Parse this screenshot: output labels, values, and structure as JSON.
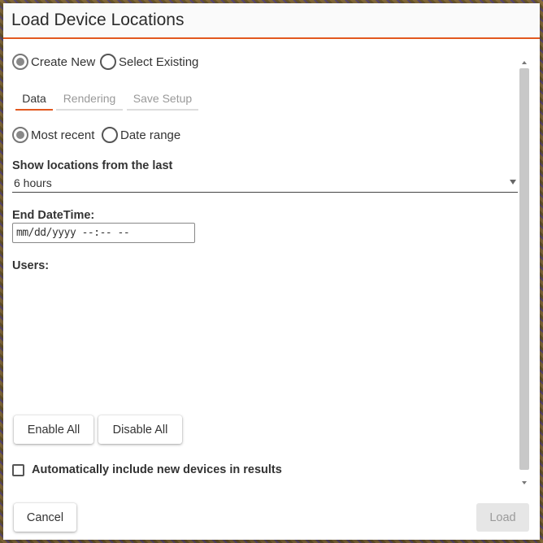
{
  "dialog": {
    "title": "Load Device Locations"
  },
  "mode": {
    "create_new": "Create New",
    "select_existing": "Select Existing",
    "selected": "create_new"
  },
  "tabs": [
    {
      "label": "Data",
      "active": true
    },
    {
      "label": "Rendering",
      "active": false
    },
    {
      "label": "Save Setup",
      "active": false
    }
  ],
  "range": {
    "most_recent": "Most recent",
    "date_range": "Date range",
    "selected": "most_recent"
  },
  "show_locations": {
    "label": "Show locations from the last",
    "value": "6 hours"
  },
  "end_datetime": {
    "label": "End DateTime:",
    "placeholder": "mm/dd/yyyy --:-- --"
  },
  "users": {
    "label": "Users:"
  },
  "buttons": {
    "enable_all": "Enable All",
    "disable_all": "Disable All",
    "cancel": "Cancel",
    "load": "Load"
  },
  "auto_include": {
    "label": "Automatically include new devices in results",
    "checked": false
  },
  "colors": {
    "accent": "#e2581f",
    "disabled_bg": "#e6e6e6"
  }
}
